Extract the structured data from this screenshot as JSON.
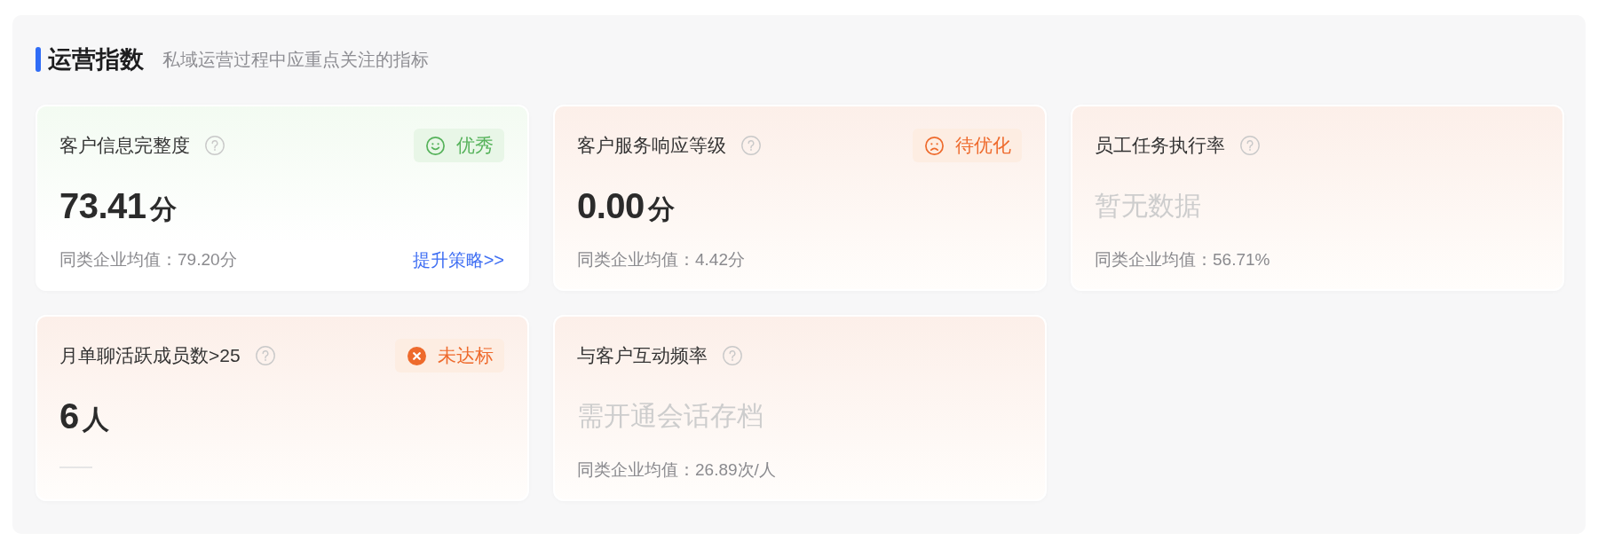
{
  "section": {
    "title": "运营指数",
    "subtitle": "私域运营过程中应重点关注的指标"
  },
  "cards": [
    {
      "title": "客户信息完整度",
      "kind": "good",
      "badge": {
        "kind": "smile",
        "label": "优秀"
      },
      "value": {
        "kind": "number",
        "number": "73.41",
        "unit": "分"
      },
      "average": "同类企业均值：79.20分",
      "link": "提升策略>>"
    },
    {
      "title": "客户服务响应等级",
      "kind": "warn",
      "badge": {
        "kind": "frown",
        "label": "待优化"
      },
      "value": {
        "kind": "number",
        "number": "0.00",
        "unit": "分"
      },
      "average": "同类企业均值：4.42分"
    },
    {
      "title": "员工任务执行率",
      "kind": "warn",
      "value": {
        "kind": "empty",
        "text": "暂无数据"
      },
      "average": "同类企业均值：56.71%"
    },
    {
      "title": "月单聊活跃成员数>25",
      "kind": "warn",
      "badge": {
        "kind": "cross",
        "label": "未达标"
      },
      "value": {
        "kind": "number",
        "number": "6",
        "unit": "人"
      }
    },
    {
      "title": "与客户互动频率",
      "kind": "warn",
      "value": {
        "kind": "empty",
        "text": "需开通会话存档"
      },
      "average": "同类企业均值：26.89次/人"
    }
  ]
}
